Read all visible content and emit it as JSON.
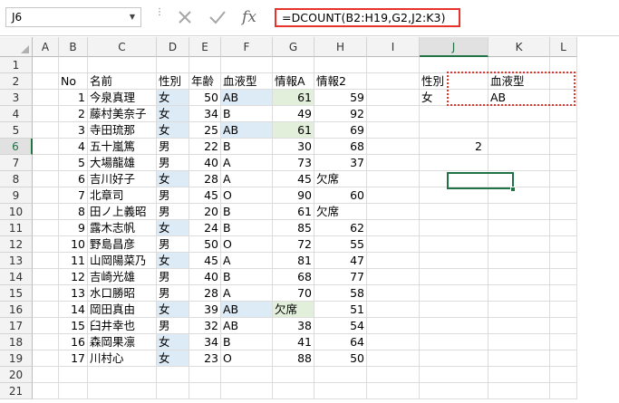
{
  "formula_bar": {
    "name_box": "J6",
    "formula": "=DCOUNT(B2:H19,G2,J2:K3)",
    "cancel_icon": "cancel-x-icon",
    "enter_icon": "check-icon",
    "function_icon": "fx-icon"
  },
  "columns": [
    "A",
    "B",
    "C",
    "D",
    "E",
    "F",
    "G",
    "H",
    "I",
    "J",
    "K",
    "L"
  ],
  "selected_column": "J",
  "selected_row": "6",
  "row_numbers": [
    "1",
    "2",
    "3",
    "4",
    "5",
    "6",
    "7",
    "8",
    "9",
    "10",
    "11",
    "12",
    "13",
    "14",
    "15",
    "16",
    "17",
    "18",
    "19",
    "20",
    "21"
  ],
  "table": {
    "headers": [
      "No",
      "名前",
      "性別",
      "年齢",
      "血液型",
      "情報A",
      "情報2"
    ],
    "rows": [
      [
        "1",
        "今泉真理",
        "女",
        "50",
        "AB",
        "61",
        "59"
      ],
      [
        "2",
        "藤村美奈子",
        "女",
        "34",
        "B",
        "49",
        "92"
      ],
      [
        "3",
        "寺田琉那",
        "女",
        "25",
        "AB",
        "61",
        "69"
      ],
      [
        "4",
        "五十嵐篤",
        "男",
        "22",
        "B",
        "30",
        "68"
      ],
      [
        "5",
        "大場龍雄",
        "男",
        "40",
        "A",
        "73",
        "37"
      ],
      [
        "6",
        "吉川好子",
        "女",
        "28",
        "A",
        "45",
        "欠席"
      ],
      [
        "7",
        "北章司",
        "男",
        "45",
        "O",
        "90",
        "60"
      ],
      [
        "8",
        "田ノ上義昭",
        "男",
        "20",
        "B",
        "61",
        "欠席"
      ],
      [
        "9",
        "露木志帆",
        "女",
        "24",
        "B",
        "85",
        "62"
      ],
      [
        "10",
        "野島昌彦",
        "男",
        "50",
        "O",
        "72",
        "55"
      ],
      [
        "11",
        "山岡陽菜乃",
        "女",
        "45",
        "A",
        "81",
        "47"
      ],
      [
        "12",
        "吉崎光雄",
        "男",
        "40",
        "B",
        "68",
        "77"
      ],
      [
        "13",
        "水口勝昭",
        "男",
        "28",
        "A",
        "70",
        "58"
      ],
      [
        "14",
        "岡田真由",
        "女",
        "39",
        "AB",
        "欠席",
        "51"
      ],
      [
        "15",
        "臼井幸也",
        "男",
        "32",
        "AB",
        "38",
        "54"
      ],
      [
        "16",
        "森岡果凛",
        "女",
        "34",
        "B",
        "41",
        "64"
      ],
      [
        "17",
        "川村心",
        "女",
        "23",
        "O",
        "88",
        "50"
      ]
    ]
  },
  "criteria": {
    "headers": [
      "性別",
      "血液型"
    ],
    "values": [
      "女",
      "AB"
    ]
  },
  "result": "2",
  "colors": {
    "highlight_blue": "#ddebf7",
    "highlight_green": "#e2efda",
    "accent_green": "#217346",
    "annotation_red": "#e8322c"
  }
}
